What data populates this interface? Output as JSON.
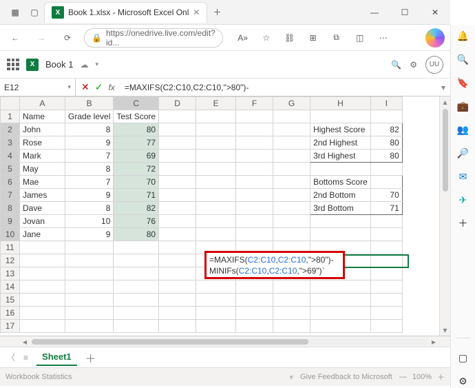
{
  "browser": {
    "tab_title": "Book 1.xlsx - Microsoft Excel Onl",
    "url": "https://onedrive.live.com/edit?id..."
  },
  "workbook": {
    "name": "Book 1",
    "avatar": "UU"
  },
  "name_box": "E12",
  "formula_bar": "=MAXIFS(C2:C10,C2:C10,\">80\")-",
  "formula_overlay": {
    "part1a": "=MAXIFS(",
    "ref1": "C2:C10",
    "part1b": ",",
    "ref2": "C2:C10",
    "part1c": ",\">80\")-",
    "part2a": "MINIFs(",
    "ref3": "C2:C10",
    "part2b": ",",
    "ref4": "C2:C10",
    "part2c": ",\">69\")`"
  },
  "columns": [
    "A",
    "B",
    "C",
    "D",
    "E",
    "F",
    "G",
    "H",
    "I"
  ],
  "headers": {
    "A1": "Name",
    "B1": "Grade level",
    "C1": "Test Score"
  },
  "data_rows": [
    {
      "name": "John",
      "grade": 8,
      "score": 80
    },
    {
      "name": "Rose",
      "grade": 9,
      "score": 77
    },
    {
      "name": "Mark",
      "grade": 7,
      "score": 69
    },
    {
      "name": "May",
      "grade": 8,
      "score": 72
    },
    {
      "name": "Mae",
      "grade": 7,
      "score": 70
    },
    {
      "name": "James",
      "grade": 9,
      "score": 71
    },
    {
      "name": "Dave",
      "grade": 8,
      "score": 82
    },
    {
      "name": "Jovan",
      "grade": 10,
      "score": 76
    },
    {
      "name": "Jane",
      "grade": 9,
      "score": 80
    }
  ],
  "stats_top": [
    {
      "label": "Highest Score",
      "value": 82
    },
    {
      "label": "2nd Highest",
      "value": 80
    },
    {
      "label": "3rd Highest",
      "value": 80
    }
  ],
  "stats_bottom": [
    {
      "label": "Bottoms Score",
      "value": ""
    },
    {
      "label": "2nd Bottom",
      "value": 70
    },
    {
      "label": "3rd Bottom",
      "value": 71
    }
  ],
  "sheet_tab": "Sheet1",
  "status": {
    "left": "Workbook Statistics",
    "feedback": "Give Feedback to Microsoft",
    "zoom": "100%"
  }
}
